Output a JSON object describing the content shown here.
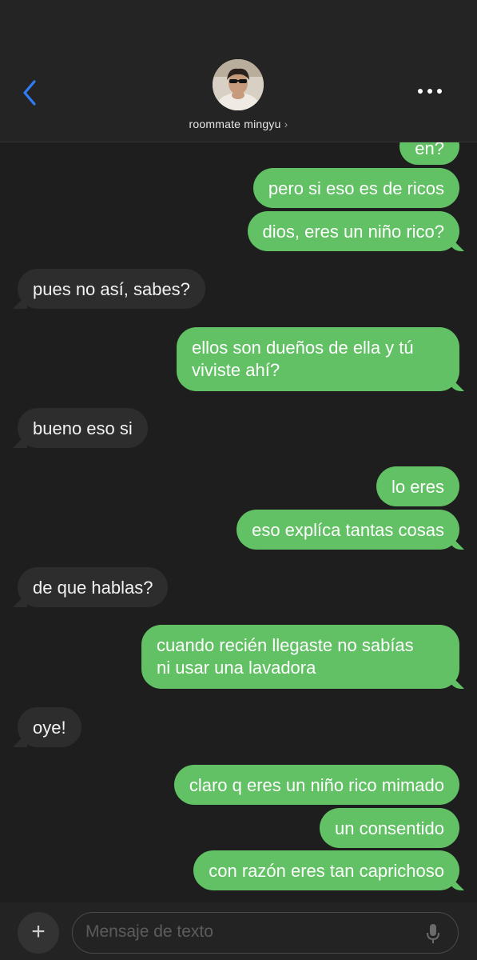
{
  "header": {
    "contact_name": "roommate mingyu",
    "chevron": "›",
    "icons": {
      "back": "chevron-left-icon",
      "more": "ellipsis-icon"
    }
  },
  "messages": [
    {
      "id": "m0",
      "from": "me",
      "text": "en?"
    },
    {
      "id": "m1",
      "from": "me",
      "text": "pero si eso es de ricos"
    },
    {
      "id": "m2",
      "from": "me",
      "text": "dios, eres un niño rico?"
    },
    {
      "id": "m3",
      "from": "them",
      "text": "pues no así, sabes?"
    },
    {
      "id": "m4",
      "from": "me",
      "lines": [
        "ellos son dueños de ella y tú",
        "viviste ahí?"
      ]
    },
    {
      "id": "m5",
      "from": "them",
      "text": "bueno eso si"
    },
    {
      "id": "m6",
      "from": "me",
      "text": "lo eres"
    },
    {
      "id": "m7",
      "from": "me",
      "text": "eso explíca tantas cosas"
    },
    {
      "id": "m8",
      "from": "them",
      "text": "de que hablas?"
    },
    {
      "id": "m9",
      "from": "me",
      "lines": [
        "cuando recién llegaste no sabías",
        "ni usar una lavadora"
      ]
    },
    {
      "id": "m10",
      "from": "them",
      "text": "oye!"
    },
    {
      "id": "m11",
      "from": "me",
      "text": "claro q eres un niño rico mimado"
    },
    {
      "id": "m12",
      "from": "me",
      "text": "un consentido"
    },
    {
      "id": "m13",
      "from": "me",
      "text": "con razón eres tan caprichoso"
    }
  ],
  "composer": {
    "plus": "+",
    "placeholder": "Mensaje de texto",
    "mic_icon": "microphone-icon"
  },
  "colors": {
    "sent_bubble": "#61c164",
    "received_bubble": "#2d2d2d",
    "background": "#1e1e1e",
    "accent": "#2f7cf6"
  }
}
